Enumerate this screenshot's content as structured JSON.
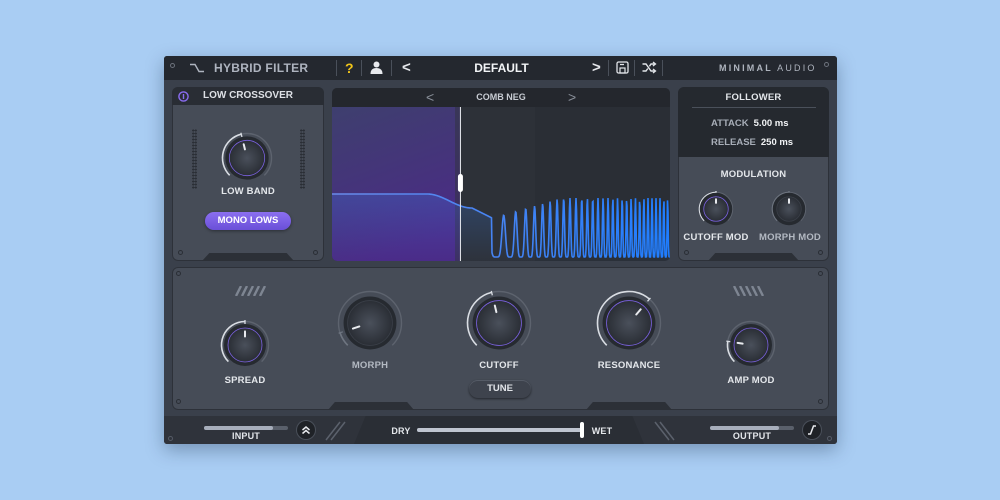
{
  "header": {
    "title": "HYBRID FILTER",
    "help_label": "?",
    "prev_label": "<",
    "preset_name": "DEFAULT",
    "next_label": ">",
    "brand_bold": "MINIMAL",
    "brand_light": "AUDIO",
    "icons": [
      "filter-logo-icon",
      "help-icon",
      "user-icon",
      "save-icon",
      "shuffle-icon"
    ]
  },
  "low_crossover": {
    "title": "LOW CROSSOVER",
    "enabled": true,
    "knob_label": "LOW BAND",
    "knob_value": 0.45,
    "mono_button": "MONO LOWS",
    "mono_active": true
  },
  "graph": {
    "filter_type": "COMB NEG",
    "prev_label": "<",
    "next_label": ">",
    "crossover_position": 0.38,
    "accent_color": "#3b82f6",
    "low_region_color": "#5b3aa6"
  },
  "follower": {
    "title": "FOLLOWER",
    "attack_label": "ATTACK",
    "attack_value": "5.00 ms",
    "release_label": "RELEASE",
    "release_value": "250 ms"
  },
  "modulation": {
    "title": "MODULATION",
    "knobs": [
      {
        "label": "CUTOFF MOD",
        "value": 0.5,
        "active": true
      },
      {
        "label": "MORPH MOD",
        "value": 0.5,
        "active": false
      }
    ]
  },
  "main": {
    "knobs": [
      {
        "id": "spread",
        "label": "SPREAD",
        "value": 0.5,
        "active": true
      },
      {
        "id": "morph",
        "label": "MORPH",
        "value": 0.1,
        "active": false
      },
      {
        "id": "cutoff",
        "label": "CUTOFF",
        "value": 0.45,
        "active": true
      },
      {
        "id": "resonance",
        "label": "RESONANCE",
        "value": 0.65,
        "active": true
      },
      {
        "id": "amp-mod",
        "label": "AMP MOD",
        "value": 0.2,
        "active": true
      }
    ],
    "tune_label": "TUNE"
  },
  "footer": {
    "input_label": "INPUT",
    "input_level": 0.82,
    "dry_label": "DRY",
    "wet_label": "WET",
    "mix_value": 1.0,
    "output_label": "OUTPUT",
    "output_level": 0.82
  }
}
